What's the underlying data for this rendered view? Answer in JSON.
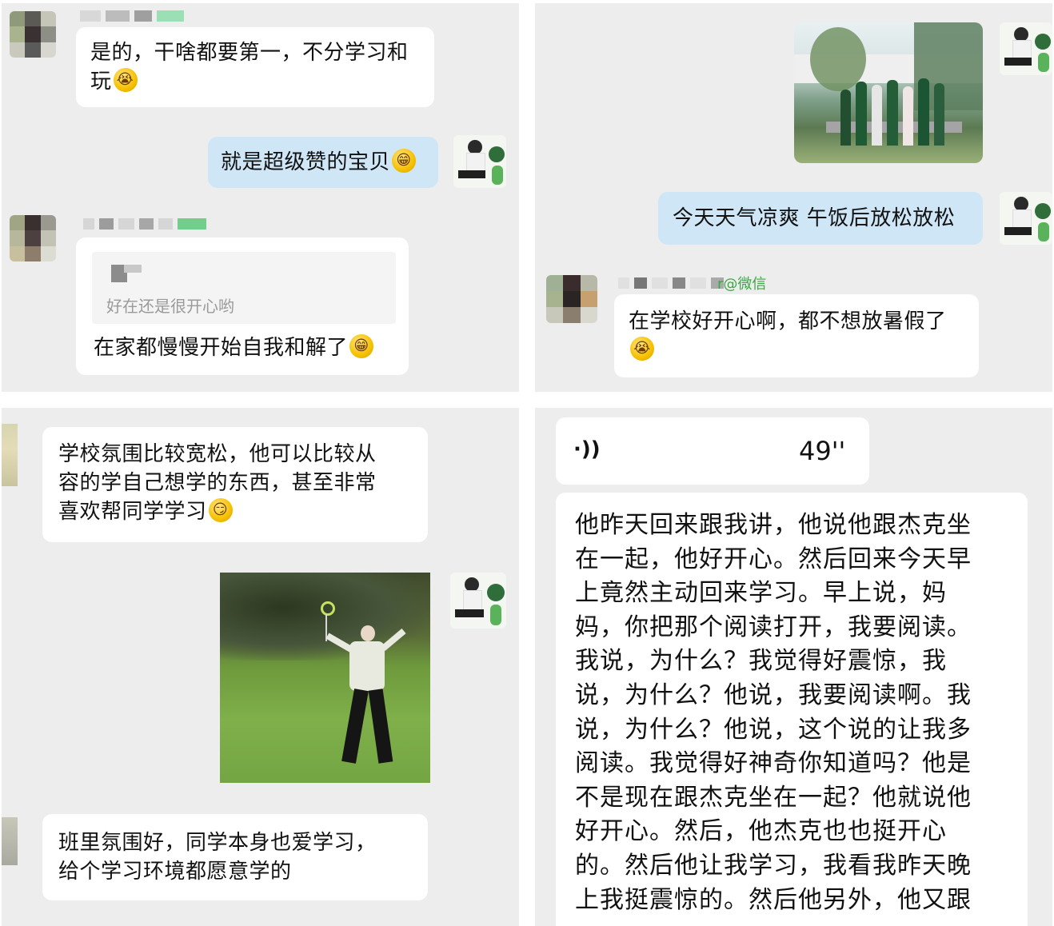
{
  "panel1": {
    "msg1": "是的，干啥都要第一，不分学习和",
    "msg1_line2": "玩",
    "msg2": "就是超级赞的宝贝",
    "quote_text": "好在还是很开心哟",
    "msg3": "在家都慢慢开始自我和解了"
  },
  "panel2": {
    "photo_label": "photo-of-children-at-school",
    "msg1": "今天天气凉爽 午饭后放松放松",
    "sender_suffix": "r@微信",
    "msg2": "在学校好开心啊，都不想放暑假了"
  },
  "panel3": {
    "msg1_l1": "学校氛围比较宽松，他可以比较从",
    "msg1_l2": "容的学自己想学的东西，甚至非常",
    "msg1_l3": "喜欢帮同学学习",
    "gif_label": "dancing-grandpa-gif",
    "msg2_l1": "班里氛围好，同学本身也爱学习，",
    "msg2_l2": "给个学习环境都愿意学的"
  },
  "panel4": {
    "voice_icon": "·))",
    "voice_duration": "49''",
    "transcript": [
      "他昨天回来跟我讲，他说他跟杰克坐",
      "在一起，他好开心。然后回来今天早",
      "上竟然主动回来学习。早上说，妈",
      "妈，你把那个阅读打开，我要阅读。",
      "我说，为什么？我觉得好震惊，我",
      "说，为什么？他说，我要阅读啊。我",
      "说，为什么？他说，这个说的让我多",
      "阅读。我觉得好神奇你知道吗？他是",
      "不是现在跟杰克坐在一起？他就说他",
      "好开心。然后，他杰克也也挺开心",
      "的。然后他让我学习，我看我昨天晚",
      "上我挺震惊的。然后他另外，他又跟"
    ]
  }
}
